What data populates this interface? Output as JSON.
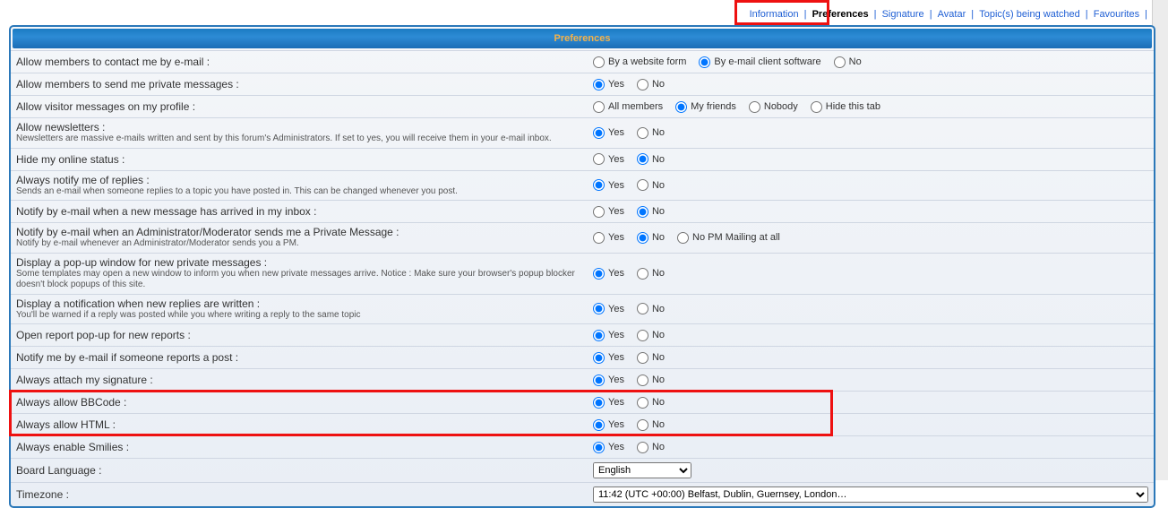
{
  "nav": {
    "items": [
      {
        "label": "Information",
        "active": false
      },
      {
        "label": "Preferences",
        "active": true
      },
      {
        "label": "Signature",
        "active": false
      },
      {
        "label": "Avatar",
        "active": false
      },
      {
        "label": "Topic(s) being watched",
        "active": false
      },
      {
        "label": "Favourites",
        "active": false
      }
    ]
  },
  "panel_title": "Preferences",
  "rows": [
    {
      "key": "contact_email",
      "label": "Allow members to contact me by e-mail :",
      "desc": "",
      "options": [
        "By a website form",
        "By e-mail client software",
        "No"
      ],
      "selected": 1
    },
    {
      "key": "private_messages",
      "label": "Allow members to send me private messages :",
      "desc": "",
      "options": [
        "Yes",
        "No"
      ],
      "selected": 0
    },
    {
      "key": "visitor_messages",
      "label": "Allow visitor messages on my profile :",
      "desc": "",
      "options": [
        "All members",
        "My friends",
        "Nobody",
        "Hide this tab"
      ],
      "selected": 1
    },
    {
      "key": "newsletters",
      "label": "Allow newsletters :",
      "desc": "Newsletters are massive e-mails written and sent by this forum's Administrators. If set to yes, you will receive them in your e-mail inbox.",
      "options": [
        "Yes",
        "No"
      ],
      "selected": 0
    },
    {
      "key": "hide_online",
      "label": "Hide my online status :",
      "desc": "",
      "options": [
        "Yes",
        "No"
      ],
      "selected": 1
    },
    {
      "key": "notify_replies",
      "label": "Always notify me of replies :",
      "desc": "Sends an e-mail when someone replies to a topic you have posted in. This can be changed whenever you post.",
      "options": [
        "Yes",
        "No"
      ],
      "selected": 0
    },
    {
      "key": "notify_new_msg",
      "label": "Notify by e-mail when a new message has arrived in my inbox :",
      "desc": "",
      "options": [
        "Yes",
        "No"
      ],
      "selected": 1
    },
    {
      "key": "notify_admin_pm",
      "label": "Notify by e-mail when an Administrator/Moderator sends me a Private Message :",
      "desc": "Notify by e-mail whenever an Administrator/Moderator sends you a PM.",
      "options": [
        "Yes",
        "No",
        "No PM Mailing at all"
      ],
      "selected": 1
    },
    {
      "key": "popup_pm",
      "label": "Display a pop-up window for new private messages :",
      "desc": "Some templates may open a new window to inform you when new private messages arrive. Notice : Make sure your browser's popup blocker doesn't block popups of this site.",
      "options": [
        "Yes",
        "No"
      ],
      "selected": 0
    },
    {
      "key": "notif_replies_written",
      "label": "Display a notification when new replies are written :",
      "desc": "You'll be warned if a reply was posted while you where writing a reply to the same topic",
      "options": [
        "Yes",
        "No"
      ],
      "selected": 0
    },
    {
      "key": "report_popup",
      "label": "Open report pop-up for new reports :",
      "desc": "",
      "options": [
        "Yes",
        "No"
      ],
      "selected": 0
    },
    {
      "key": "notify_report",
      "label": "Notify me by e-mail if someone reports a post :",
      "desc": "",
      "options": [
        "Yes",
        "No"
      ],
      "selected": 0
    },
    {
      "key": "attach_sig",
      "label": "Always attach my signature :",
      "desc": "",
      "options": [
        "Yes",
        "No"
      ],
      "selected": 0
    },
    {
      "key": "allow_bbcode",
      "label": "Always allow BBCode :",
      "desc": "",
      "options": [
        "Yes",
        "No"
      ],
      "selected": 0,
      "highlight": true
    },
    {
      "key": "allow_html",
      "label": "Always allow HTML :",
      "desc": "",
      "options": [
        "Yes",
        "No"
      ],
      "selected": 0,
      "highlight": true
    },
    {
      "key": "enable_smilies",
      "label": "Always enable Smilies :",
      "desc": "",
      "options": [
        "Yes",
        "No"
      ],
      "selected": 0
    },
    {
      "key": "board_language",
      "label": "Board Language :",
      "desc": "",
      "type": "select",
      "options": [
        "English"
      ],
      "selected": 0
    },
    {
      "key": "timezone",
      "label": "Timezone :",
      "desc": "",
      "type": "select",
      "options": [
        "11:42 (UTC +00:00) Belfast, Dublin, Guernsey, London…"
      ],
      "selected": 0,
      "wide": true
    }
  ]
}
